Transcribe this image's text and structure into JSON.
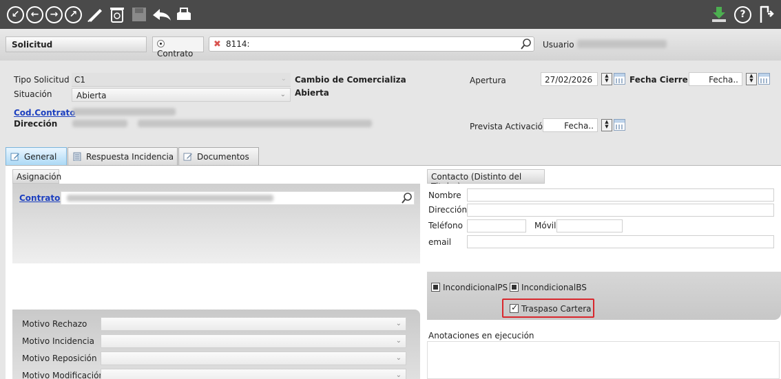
{
  "toolbar": {
    "icons": [
      "first-icon",
      "back-icon",
      "forward-icon",
      "last-icon",
      "brush-icon",
      "trash-icon",
      "save-icon",
      "undo-icon",
      "print-icon",
      "download-icon",
      "help-icon",
      "exit-icon"
    ]
  },
  "header": {
    "section_title": "Solicitud",
    "radio_label": "Contrato",
    "search_value": "8114:",
    "usuario_label": "Usuario"
  },
  "form": {
    "tipo_solicitud_label": "Tipo Solicitud",
    "tipo_solicitud_value": "C1",
    "tipo_desc": "Cambio de Comercializa",
    "situacion_label": "Situación",
    "situacion_value": "Abierta",
    "situacion_desc": "Abierta",
    "cod_contrato_label": "Cod.Contrato",
    "direccion_label": "Dirección",
    "apertura_label": "Apertura",
    "apertura_value": "27/02/2026",
    "fecha_cierre_label": "Fecha Cierre",
    "fecha_cierre_placeholder": "Fecha..",
    "prevista_label": "Prevista Activación",
    "prevista_placeholder": "Fecha.."
  },
  "tabs": [
    {
      "label": "General",
      "active": true
    },
    {
      "label": "Respuesta Incidencia",
      "active": false
    },
    {
      "label": "Documentos",
      "active": false
    }
  ],
  "asignacion": {
    "title": "Asignación",
    "contrato_label": "Contrato"
  },
  "contacto": {
    "title": "Contacto (Distinto del Titular)",
    "nombre_label": "Nombre",
    "direccion_label": "Dirección",
    "telefono_label": "Teléfono",
    "movil_label": "Móvil",
    "email_label": "email"
  },
  "checks": {
    "incondicional_ps": "IncondicionalPS",
    "incondicional_bs": "IncondicionalBS",
    "traspaso_cartera": "Traspaso Cartera",
    "traspaso_checked": true
  },
  "motivos": {
    "rechazo": "Motivo Rechazo",
    "incidencia": "Motivo Incidencia",
    "reposicion": "Motivo Reposición",
    "modificacion": "Motivo Modificación"
  },
  "anotaciones": {
    "title": "Anotaciones en ejecución"
  },
  "colors": {
    "toolbar_bg": "#4a4a4a",
    "link": "#1c3fbf",
    "highlight_border": "#d9262c",
    "active_tab": "#a9d8f5"
  }
}
